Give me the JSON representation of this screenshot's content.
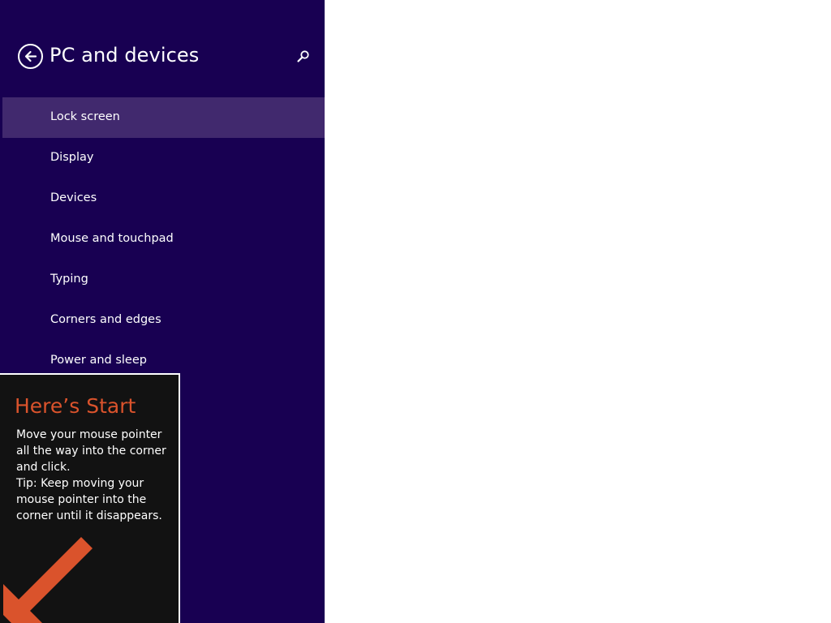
{
  "colors": {
    "sidebar_background": "#180052",
    "selected_item_background": "#41296e",
    "tip_background": "#121212",
    "tip_accent": "#da532c",
    "content_background": "#ffffff"
  },
  "header": {
    "title": "PC and devices",
    "back_icon": "back-arrow-icon",
    "search_icon": "search-icon"
  },
  "nav": {
    "selected": "Lock screen",
    "items": [
      {
        "label": "Lock screen"
      },
      {
        "label": "Display"
      },
      {
        "label": "Devices"
      },
      {
        "label": "Mouse and touchpad"
      },
      {
        "label": "Typing"
      },
      {
        "label": "Corners and edges"
      },
      {
        "label": "Power and sleep"
      }
    ]
  },
  "tip": {
    "title": "Here’s Start",
    "line1": "Move your mouse pointer all the way into the corner and click.",
    "line2": "Tip: Keep moving your mouse pointer into the corner until it disappears.",
    "arrow_icon": "corner-arrow-icon"
  }
}
